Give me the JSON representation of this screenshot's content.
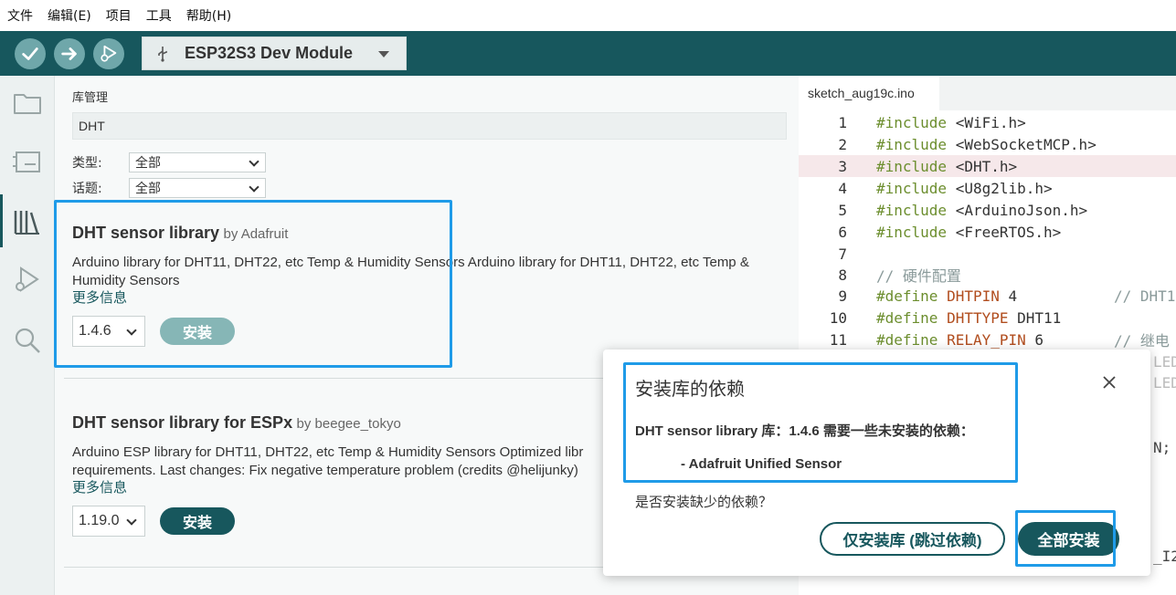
{
  "menu": [
    "文件",
    "编辑(E)",
    "项目",
    "工具",
    "帮助(H)"
  ],
  "toolbar": {
    "board": "ESP32S3 Dev Module"
  },
  "library": {
    "title": "库管理",
    "search_value": "DHT",
    "filters": [
      {
        "label": "类型:",
        "value": "全部"
      },
      {
        "label": "话题:",
        "value": "全部"
      }
    ],
    "items": [
      {
        "name": "DHT sensor library",
        "by": "by Adafruit",
        "description": "Arduino library for DHT11, DHT22, etc Temp & Humidity Sensors Arduino library for DHT11, DHT22, etc Temp & Humidity Sensors",
        "more": "更多信息",
        "version": "1.4.6",
        "install": "安装",
        "install_enabled": false
      },
      {
        "name": "DHT sensor library for ESPx",
        "by": "by beegee_tokyo",
        "description": "Arduino ESP library for DHT11, DHT22, etc Temp & Humidity Sensors Optimized libr requirements. Last changes: Fix negative temperature problem (credits @helijunky)",
        "more": "更多信息",
        "version": "1.19.0",
        "install": "安装",
        "install_enabled": true
      }
    ]
  },
  "editor": {
    "tab": "sketch_aug19c.ino",
    "lines": [
      {
        "n": "1",
        "kw": "#include",
        "rest": " <WiFi.h>"
      },
      {
        "n": "2",
        "kw": "#include",
        "rest": " <WebSocketMCP.h>"
      },
      {
        "n": "3",
        "kw": "#include",
        "rest": " <DHT.h>"
      },
      {
        "n": "4",
        "kw": "#include",
        "rest": " <U8g2lib.h>"
      },
      {
        "n": "5",
        "kw": "#include",
        "rest": " <ArduinoJson.h>"
      },
      {
        "n": "6",
        "kw": "#include",
        "rest": " <FreeRTOS.h>"
      },
      {
        "n": "7",
        "kw": "",
        "rest": ""
      },
      {
        "n": "8",
        "comment": "// 硬件配置"
      },
      {
        "n": "9",
        "kw": "#define",
        "macro": "DHTPIN",
        "rest": " 4",
        "comment": "// DHT1"
      },
      {
        "n": "10",
        "kw": "#define",
        "macro": "DHTTYPE",
        "rest": " DHT11"
      },
      {
        "n": "11",
        "kw": "#define",
        "macro": "RELAY_PIN",
        "rest": " 6",
        "comment": "// 继电"
      }
    ],
    "fragments": [
      "LED",
      "LED",
      "N;",
      "_I2"
    ]
  },
  "dialog": {
    "title": "安装库的依赖",
    "message": "DHT sensor library 库：1.4.6 需要一些未安装的依赖：",
    "dependency": "- Adafruit Unified Sensor",
    "question": "是否安装缺少的依赖？",
    "btn_only": "仅安装库 (跳过依赖)",
    "btn_all": "全部安装"
  }
}
